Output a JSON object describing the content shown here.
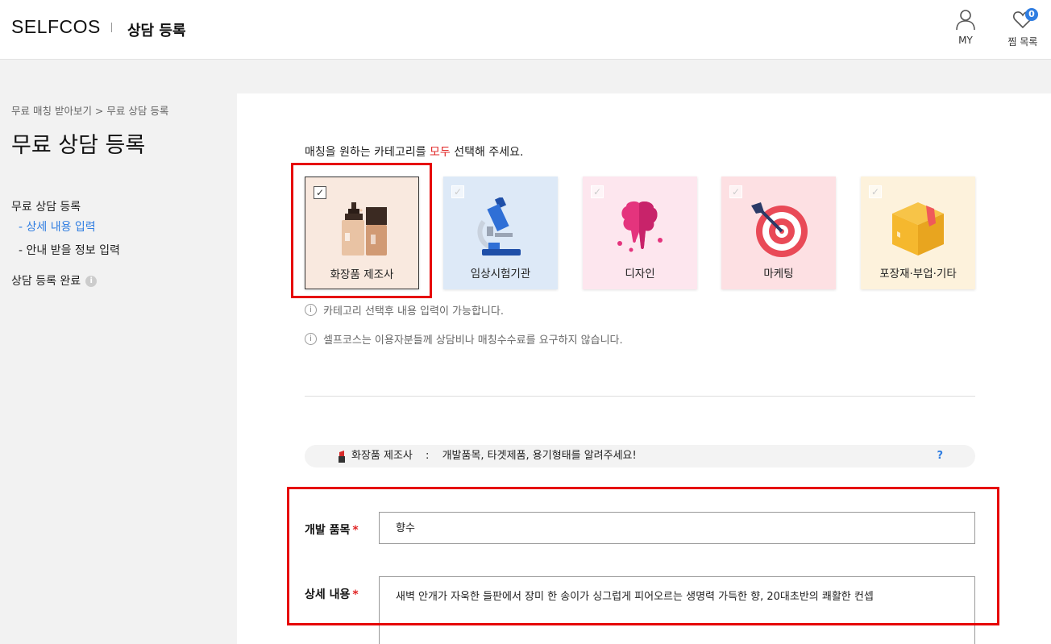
{
  "header": {
    "logo": "SELFCOS",
    "title": "상담 등록",
    "my_label": "MY",
    "wish_label": "찜 목록",
    "wish_count": "0"
  },
  "sidebar": {
    "breadcrumb": "무료 매칭 받아보기 > 무료 상담 등록",
    "page_title": "무료 상담 등록",
    "section": "무료 상담 등록",
    "sub_items": [
      "- 상세 내용 입력",
      "- 안내 받을 정보 입력"
    ],
    "active_index": 0,
    "done_label": "상담 등록 완료",
    "done_icon": "i"
  },
  "main": {
    "instruction_pre": "매칭을 원하는 카테고리를 ",
    "instruction_hl": "모두",
    "instruction_post": " 선택해 주세요.",
    "categories": [
      {
        "label": "화장품 제조사",
        "selected": true,
        "bg": "#f9e9df",
        "icon": "cosmetic-bottles-icon"
      },
      {
        "label": "임상시험기관",
        "selected": false,
        "bg": "#dde9f7",
        "icon": "microscope-icon"
      },
      {
        "label": "디자인",
        "selected": false,
        "bg": "#fde6ee",
        "icon": "paint-splash-icon"
      },
      {
        "label": "마케팅",
        "selected": false,
        "bg": "#fde0e3",
        "icon": "target-dart-icon"
      },
      {
        "label": "포장재·부업·기타",
        "selected": false,
        "bg": "#fdf2dc",
        "icon": "package-box-icon"
      }
    ],
    "check_mark": "✓",
    "notes": [
      "카테고리 선택후 내용 입력이 가능합니다.",
      "셀프코스는 이용자분들께 상담비나 매칭수수료를 요구하지 않습니다."
    ],
    "note_icon": "i",
    "hint": {
      "category": "화장품 제조사",
      "colon": ":",
      "text": "개발품목, 타겟제품, 용기형태를 알려주세요!",
      "help": "?"
    },
    "form": {
      "item_label": "개발 품목",
      "item_value": "향수",
      "detail_label": "상세 내용",
      "detail_value": "새벽 안개가 자욱한 들판에서 장미 한 송이가 싱그럽게 피어오르는 생명력 가득한 향, 20대초반의 쾌활한 컨셉",
      "required_mark": "*"
    }
  },
  "colors": {
    "accent": "#2f7de1",
    "highlight_red": "#e02424",
    "annotation_red": "#e60000"
  }
}
